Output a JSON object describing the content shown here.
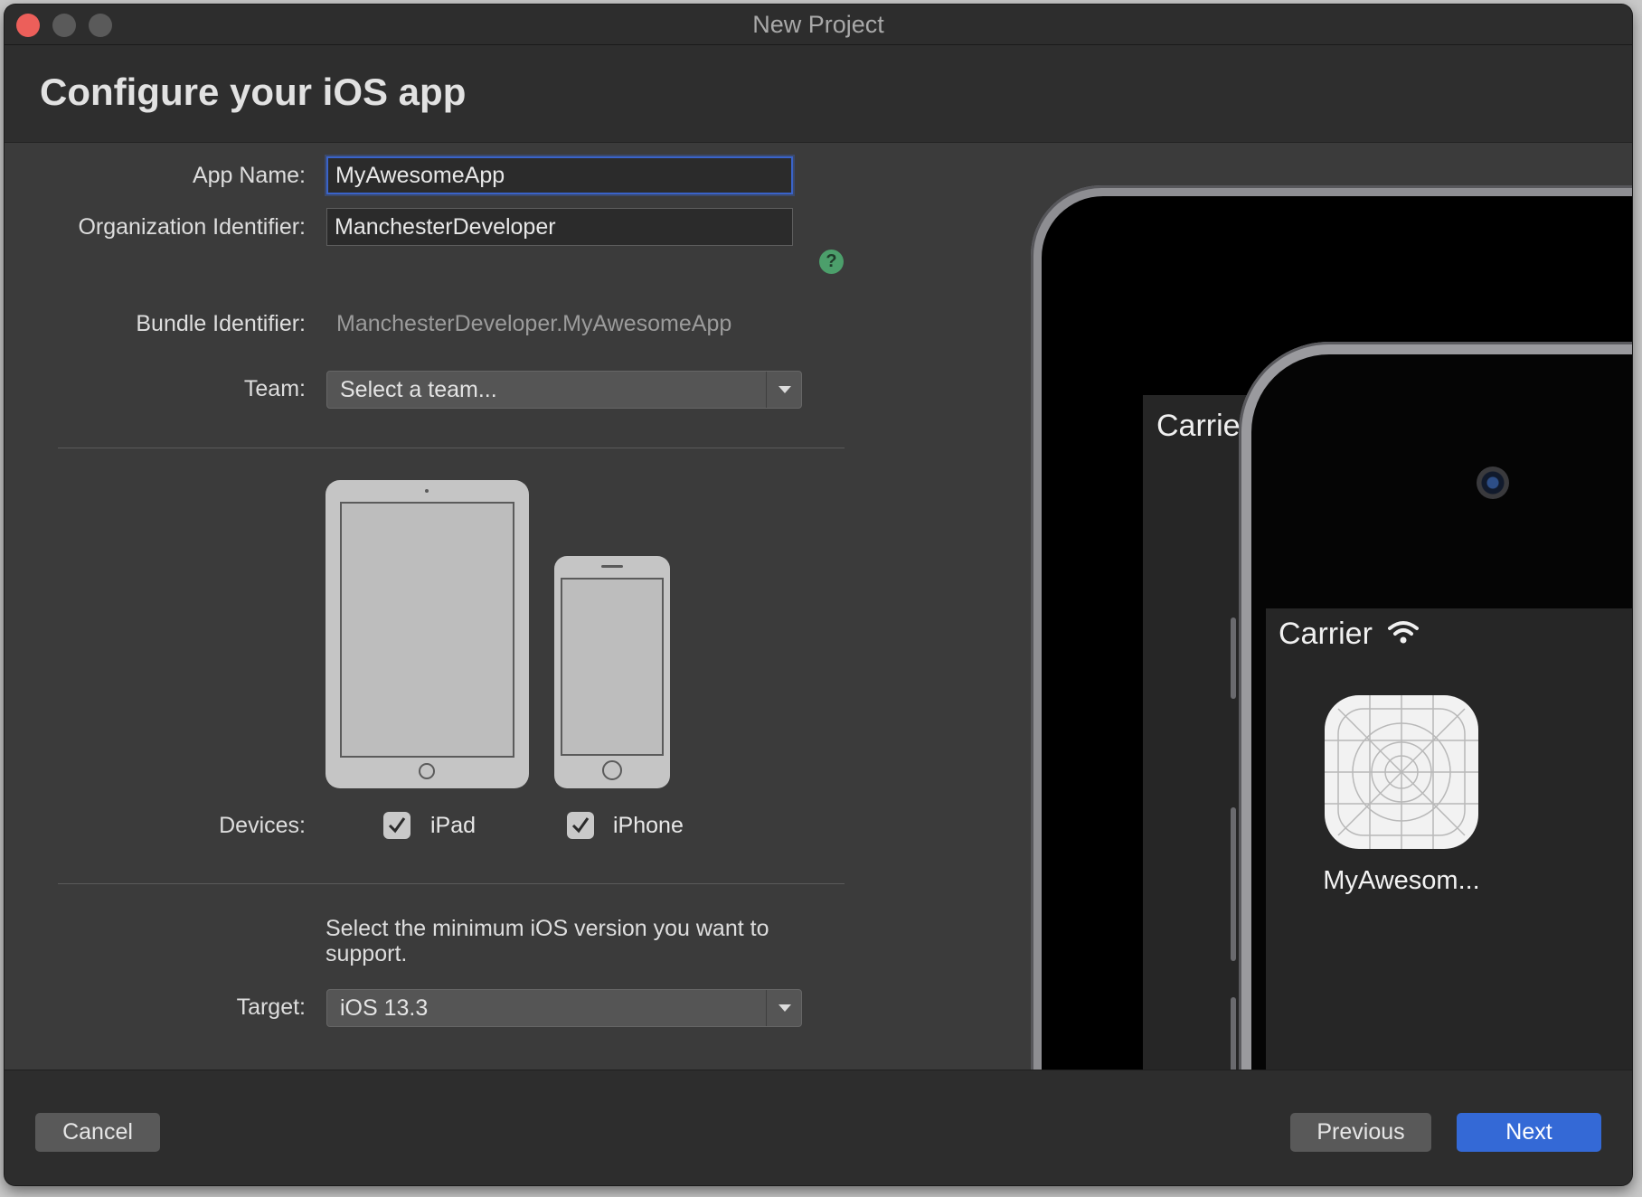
{
  "window": {
    "title": "New Project"
  },
  "header": {
    "title": "Configure your iOS app"
  },
  "form": {
    "app_name": {
      "label": "App Name:",
      "value": "MyAwesomeApp"
    },
    "org_id": {
      "label": "Organization Identifier:",
      "value": "ManchesterDeveloper",
      "help": "?"
    },
    "bundle_id": {
      "label": "Bundle Identifier:",
      "value": "ManchesterDeveloper.MyAwesomeApp"
    },
    "team": {
      "label": "Team:",
      "value": "Select a team..."
    },
    "devices": {
      "label": "Devices:",
      "ipad": {
        "label": "iPad",
        "checked": true
      },
      "iphone": {
        "label": "iPhone",
        "checked": true
      }
    },
    "min_version_text": "Select the minimum iOS version you want to support.",
    "target": {
      "label": "Target:",
      "value": "iOS 13.3"
    }
  },
  "preview": {
    "ipad_carrier": "Carrier",
    "iphone_carrier": "Carrier",
    "app_label": "MyAwesom..."
  },
  "footer": {
    "cancel": "Cancel",
    "previous": "Previous",
    "next": "Next"
  },
  "colors": {
    "accent": "#3469d6",
    "help": "#4c9f6b",
    "close": "#ec5f5a"
  }
}
